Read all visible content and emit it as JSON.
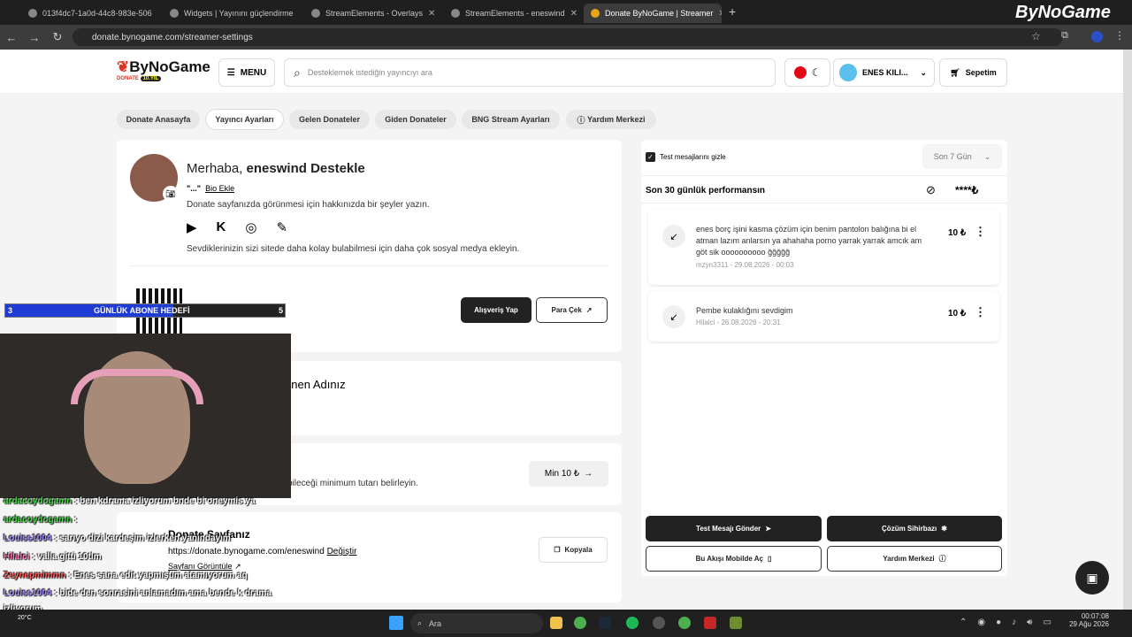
{
  "browser": {
    "tabs": [
      {
        "title": "013f4dc7-1a0d-44c8-983e-506"
      },
      {
        "title": "Widgets | Yayınını güçlendirme"
      },
      {
        "title": "StreamElements - Overlays"
      },
      {
        "title": "StreamElements - eneswind"
      },
      {
        "title": "Donate ByNoGame | Streamer"
      }
    ],
    "new_tab": "+",
    "url": "donate.bynogame.com/streamer-settings",
    "top_logo": "ByNoGame"
  },
  "header": {
    "logo": "ByNoGame",
    "logo_sub": "DONATE",
    "logo_badge": "10.YIL",
    "menu": "MENU",
    "search_placeholder": "Desteklemek istediğin yayıncıyı ara",
    "user": "ENES KILI...",
    "cart": "Sepetim"
  },
  "tabs": [
    "Donate Anasayfa",
    "Yayıncı Ayarları",
    "Gelen Donateler",
    "Giden Donateler",
    "BNG Stream Ayarları",
    "Yardım Merkezi"
  ],
  "profile": {
    "greeting": "Merhaba,",
    "name": "eneswind Destekle",
    "bio_quote": "\"...\"",
    "bio_link": "Bio Ekle",
    "bio_hint": "Donate sayfanızda görünmesi için hakkınızda bir şeyler yazın.",
    "social_hint": "Sevdiklerinizin sizi sitede daha kolay bulabilmesi için daha çok sosyal medya ekleyin.",
    "shop_button": "Alışveriş Yap",
    "withdraw_button": "Para Çek"
  },
  "display_name_card": {
    "title_partial": "ünen Adınız"
  },
  "min_card": {
    "text": "bileceği minimum tutarı belirleyin.",
    "button": "Min 10 ₺"
  },
  "donate_page": {
    "title": "Donate Sayfanız",
    "url": "https://donate.bynogame.com/eneswind",
    "change": "Değiştir",
    "view": "Sayfanı Görüntüle",
    "copy": "Kopyala"
  },
  "right": {
    "hide_test": "Test mesajlarını gizle",
    "period": "Son 7 Gün",
    "perf_label": "Son 30 günlük performansın",
    "perf_value": "****₺",
    "donations": [
      {
        "message": "enes borç işini kasma çözüm için benim pantolon balığına bi el atman lazım anlarsın ya ahahaha porno yarrak yarrak amcık am göt sik oooooooooo ğğğğğ",
        "user": "mzyn3311",
        "date": "29.08.2026 - 00:03",
        "amount": "10 ₺"
      },
      {
        "message": "Pembe kulaklığını sevdigim",
        "user": "Hilalci",
        "date": "26.08.2026 - 20:31",
        "amount": "10 ₺"
      }
    ],
    "buttons": {
      "test": "Test Mesajı Gönder",
      "wizard": "Çözüm Sihirbazı",
      "mobile": "Bu Akışı Mobilde Aç",
      "help": "Yardım Merkezi"
    }
  },
  "overlay": {
    "goal_left": "3",
    "goal_title": "GÜNLÜK ABONE HEDEFİ",
    "goal_right": "5",
    "goal_progress": 0.6,
    "chat": [
      {
        "user": "ardacoydogamn",
        "text": ": ben kdrama izliyorum bnde bi oneymis ya",
        "color": "#4cd44c"
      },
      {
        "user": "ardacoydogamn",
        "text": ":",
        "color": "#4cd44c"
      },
      {
        "user": "Louiss1004",
        "text": ": sarıyo dizi kardeşim izlerken yanındayım",
        "color": "#a88cff"
      },
      {
        "user": "Hilalci",
        "text": ": valla gitti 10tlm",
        "color": "#ff7ab8"
      },
      {
        "user": "Zeynepmimmn",
        "text": ": Enes sana edit yapmıştım atamıyorum aq",
        "color": "#ff5c5c"
      },
      {
        "user": "Louiss1004",
        "text": ": bide den sonrasini anlamadım ama bende k drama",
        "color": "#a88cff"
      },
      {
        "user": "",
        "text": "izliyorum",
        "color": "#fff"
      },
      {
        "user": "Hilalci",
        "text": ": neyse sakız alırsın",
        "color": "#ff7ab8"
      }
    ]
  },
  "taskbar": {
    "search": "Ara",
    "weather": "20°C",
    "time": "00:07:08",
    "date": "29 Ağu 2026"
  }
}
